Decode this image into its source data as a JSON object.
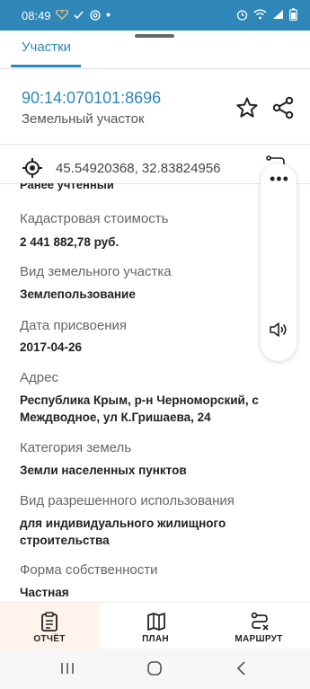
{
  "status_bar": {
    "time": "08:49",
    "left_icons": [
      "heart-rate-icon",
      "check-icon",
      "at-icon",
      "dot-icon"
    ],
    "right_icons": [
      "alarm-icon",
      "wifi-icon",
      "signal-icon",
      "battery-icon"
    ],
    "bg_color": "#2f86b8"
  },
  "tabs": {
    "active_label": "Участки"
  },
  "header": {
    "cadastral_number": "90:14:070101:8696",
    "object_type": "Земельный участок"
  },
  "location": {
    "coordinates": "45.54920368, 32.83824956"
  },
  "fields": {
    "cut_value": "Ранее учтенный",
    "items": [
      {
        "label": "Кадастровая стоимость",
        "value": "2 441 882,78 руб."
      },
      {
        "label": "Вид земельного участка",
        "value": "Землепользование"
      },
      {
        "label": "Дата присвоения",
        "value": "2017-04-26"
      },
      {
        "label": "Адрес",
        "value": "Республика Крым, р-н Черноморский, с Междводное, ул К.Гришаева, 24"
      },
      {
        "label": "Категория земель",
        "value": "Земли населенных пунктов"
      },
      {
        "label": "Вид разрешенного использования",
        "value": "для индивидуального жилищного строительства"
      },
      {
        "label": "Форма собственности",
        "value": "Частная"
      }
    ]
  },
  "side_panel": {
    "more_label": "•••"
  },
  "bottom_nav": {
    "items": [
      {
        "label": "ОТЧЁТ",
        "icon": "report-clipboard-icon"
      },
      {
        "label": "ПЛАН",
        "icon": "map-icon"
      },
      {
        "label": "МАРШРУТ",
        "icon": "route-icon"
      }
    ]
  },
  "colors": {
    "accent": "#2f86b8",
    "report_highlight": "#fff3eb"
  }
}
